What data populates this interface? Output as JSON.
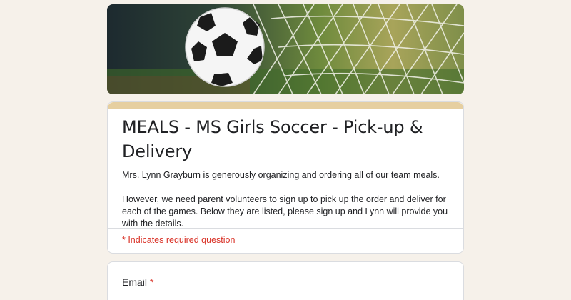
{
  "form": {
    "title": "MEALS - MS Girls Soccer - Pick-up & Delivery",
    "description": [
      "Mrs. Lynn Grayburn is generously organizing and ordering all of our team meals.",
      "However, we need parent volunteers to sign up to pick up the order and deliver for each of the games.  Below they are listed, please sign up and Lynn will provide you with the details."
    ],
    "required_note": "* Indicates required question"
  },
  "questions": [
    {
      "label": "Email",
      "required_mark": "*"
    }
  ],
  "colors": {
    "accent": "#e6cfa0",
    "required": "#d93025",
    "background": "#f6f1ea"
  }
}
